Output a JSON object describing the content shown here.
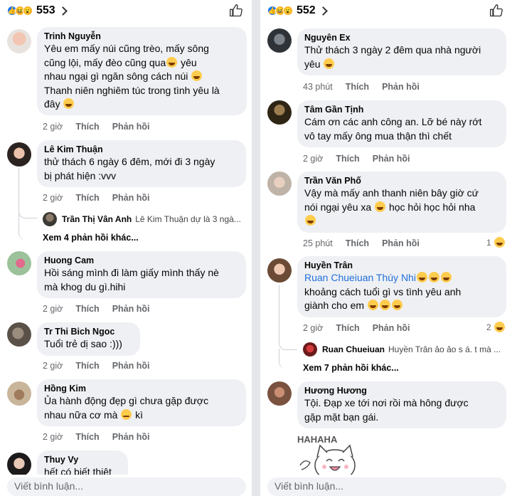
{
  "left": {
    "reaction_count": "553",
    "comments": [
      {
        "name": "Trinh Nguyễn",
        "text": "Yêu em mấy núi cũng trèo, mấy sông\ncũng lội, mấy đèo cũng qua",
        "text2": " yêu\nnhau ngại gì ngăn sông cách núi ",
        "text3": "\nThanh niên nghiêm túc trong tình yêu là\nđây ",
        "time": "2 giờ"
      },
      {
        "name": "Lê Kim Thuận",
        "text": "thử thách 6 ngày 6 đêm, mới đi 3 ngày\nbị phát hiện :vvv",
        "time": "2 giờ"
      },
      {
        "name": "Huong Cam",
        "text": "Hồi sáng mình đi làm giấy mình thấy nè\nmà khog du gì.hihi",
        "time": "2 giờ"
      },
      {
        "name": "Tr Thi Bich Ngoc",
        "text": "Tuổi trẻ dị sao :)))",
        "time": "2 giờ"
      },
      {
        "name": "Hồng Kim",
        "text": "Ủa hành động đẹp gì chưa gặp được\nnhau nữa cơ mà ",
        "text2": " kì",
        "time": "2 giờ"
      },
      {
        "name": "Thuy Vy",
        "text": "hết có biết thiệt"
      }
    ],
    "reply": {
      "name": "Trần Thị Vân Anh",
      "text": "Lê Kim Thuận dự là 3 ngà..."
    },
    "more_replies": "Xem 4 phản hồi khác..."
  },
  "right": {
    "reaction_count": "552",
    "comments": [
      {
        "name": "Nguyên Ex",
        "text": "Thử thách 3 ngày 2 đêm qua nhà người\nyêu ",
        "time": "43 phút"
      },
      {
        "name": "Tâm Gần Tịnh",
        "text": "Cám ơn các anh công an. Lỡ bé này rớt\nvô tay mấy ông mua thận thì chết",
        "time": "2 giờ"
      },
      {
        "name": "Trần Văn Phố",
        "text": "Vậy mà mấy anh thanh niên bây giờ cứ\nnói ngại yêu xa ",
        "text2": " học hỏi học hỏi nha\n",
        "time": "25 phút",
        "react_count": "1"
      },
      {
        "name": "Huyền Trân",
        "tag": "Ruan Chueiuan Thúy Nhi",
        "text": "khoảng cách tuổi gì vs tình yêu anh\ngiành cho em ",
        "time": "2 giờ",
        "react_count": "2"
      },
      {
        "name": "Hương Hương",
        "text": "Tội. Đạp xe tới nơi rồi mà hông được\ngặp mặt bạn gái."
      }
    ],
    "reply": {
      "name": "Ruan Chueiuan",
      "text": "Huyền Trân ảo ảo s á. t mà ..."
    },
    "more_replies": "Xem 7 phản hồi khác...",
    "sticker_text": "HAHAHA"
  },
  "labels": {
    "like": "Thích",
    "reply": "Phản hồi",
    "compose_placeholder": "Viết bình luận..."
  }
}
